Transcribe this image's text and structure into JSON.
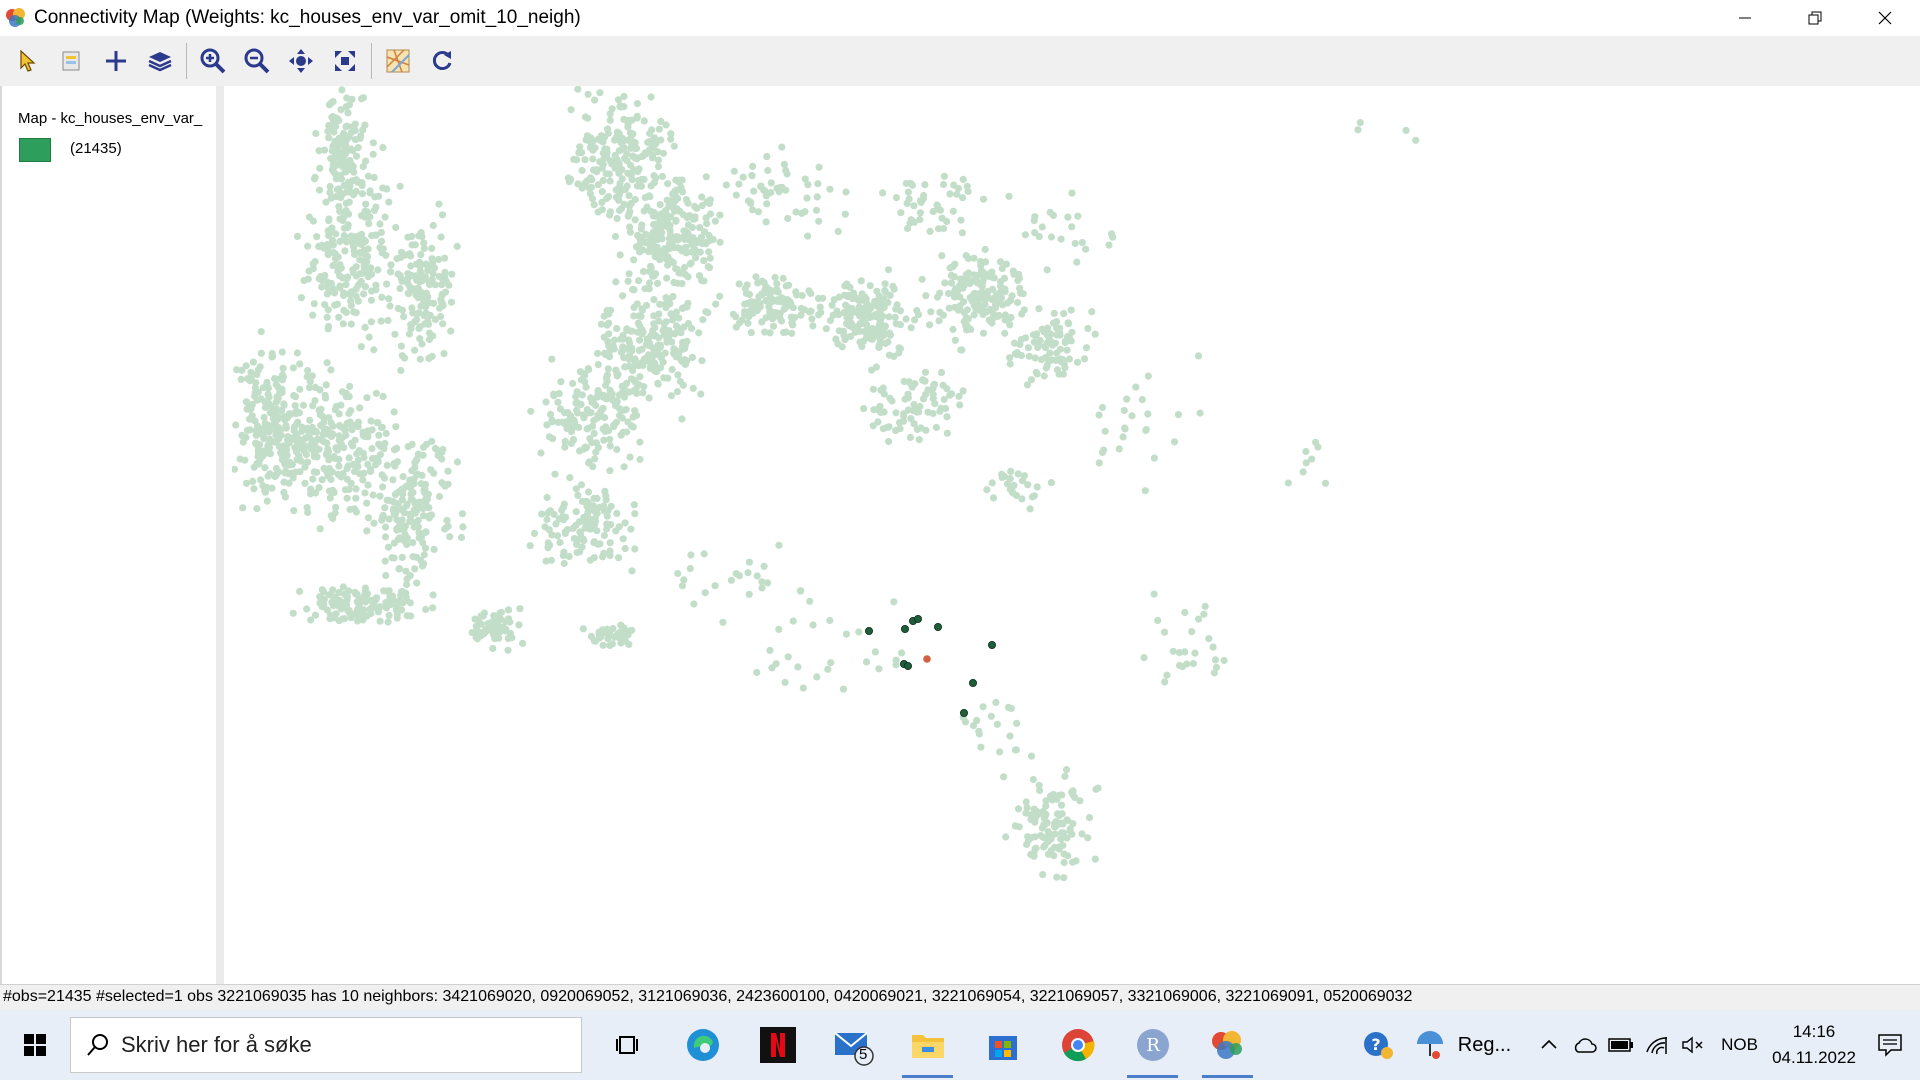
{
  "window": {
    "title": "Connectivity Map (Weights: kc_houses_env_var_omit_10_neigh)",
    "app_icon": "geoda-icon",
    "controls": [
      "minimize-icon",
      "restore-icon",
      "close-icon"
    ]
  },
  "toolbar": {
    "tools": [
      {
        "name": "select-tool",
        "icon": "pointer-icon"
      },
      {
        "name": "selection-properties",
        "icon": "select-doc-icon"
      },
      {
        "name": "add-layer",
        "icon": "plus-icon"
      },
      {
        "name": "layers",
        "icon": "layers-icon"
      },
      {
        "name": "zoom-in",
        "icon": "zoom-in-icon"
      },
      {
        "name": "zoom-out",
        "icon": "zoom-out-icon"
      },
      {
        "name": "pan",
        "icon": "pan-icon"
      },
      {
        "name": "full-extent",
        "icon": "fit-extent-icon"
      },
      {
        "name": "basemap",
        "icon": "basemap-icon"
      },
      {
        "name": "refresh",
        "icon": "refresh-icon"
      }
    ]
  },
  "legend": {
    "title": "Map - kc_houses_env_var_",
    "category_count": "(21435)",
    "swatch_color": "#2e9e5c"
  },
  "map": {
    "point_color": "#c3dec8",
    "neighbor_color": "#1e5e3a",
    "selected_color": "#d0623f"
  },
  "status": {
    "text": "#obs=21435 #selected=1  obs 3221069035 has 10 neighbors: 3421069020, 0920069052, 3121069036, 2423600100, 0420069021, 3221069054, 3221069057, 3321069006, 3221069091, 0520069032"
  },
  "taskbar": {
    "search_placeholder": "Skriv her for å søke",
    "apps": [
      "task-view-icon",
      "edge-icon",
      "netflix-icon",
      "mail-icon",
      "file-explorer-icon",
      "store-icon",
      "chrome-icon",
      "r-icon",
      "geoda-icon"
    ],
    "mail_badge": "5",
    "weather_label": "Reg...",
    "language": "NOB",
    "time": "14:16",
    "date": "04.11.2022"
  }
}
